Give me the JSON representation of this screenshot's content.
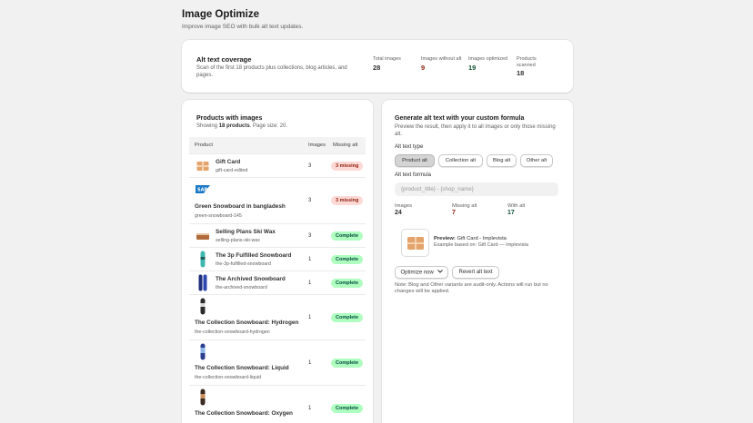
{
  "page": {
    "title": "Image Optimize",
    "subtitle": "Improve image SEO with bulk alt text updates."
  },
  "coverage": {
    "title": "Alt text coverage",
    "description": "Scan of the first 18 products plus collections, blog articles, and pages.",
    "stats": [
      {
        "label": "Total images",
        "value": "28",
        "color": "#303030"
      },
      {
        "label": "Images without alt",
        "value": "9",
        "color": "#8e1f0b"
      },
      {
        "label": "Images optimized",
        "value": "19",
        "color": "#0c5132"
      },
      {
        "label": "Products scanned",
        "value": "18",
        "color": "#303030"
      }
    ]
  },
  "products": {
    "title": "Products with images",
    "showing_prefix": "Showing ",
    "showing_count": "18 products",
    "showing_suffix": ". Page size: 20.",
    "columns": {
      "product": "Product",
      "images": "Images",
      "missing": "Missing alt"
    },
    "rows": [
      {
        "name": "Gift Card",
        "handle": "gift-card-edited",
        "images": "3",
        "status": "3 missing",
        "kind": "missing",
        "icon": "gift-card-icon"
      },
      {
        "name": "Green Snowboard in bangladesh",
        "handle": "green-snowboard-145",
        "images": "3",
        "status": "3 missing",
        "kind": "missing",
        "icon": "sap-logo-icon"
      },
      {
        "name": "Selling Plans Ski Wax",
        "handle": "selling-plans-ski-wax",
        "images": "3",
        "status": "Complete",
        "kind": "complete",
        "icon": "ski-wax-icon"
      },
      {
        "name": "The 3p Fulfilled Snowboard",
        "handle": "the-3p-fulfilled-snowboard",
        "images": "1",
        "status": "Complete",
        "kind": "complete",
        "icon": "snowboard-icon"
      },
      {
        "name": "The Archived Snowboard",
        "handle": "the-archived-snowboard",
        "images": "1",
        "status": "Complete",
        "kind": "complete",
        "icon": "snowboard-icon"
      },
      {
        "name": "The Collection Snowboard: Hydrogen",
        "handle": "the-collection-snowboard-hydrogen",
        "images": "1",
        "status": "Complete",
        "kind": "complete",
        "icon": "snowboard-icon"
      },
      {
        "name": "The Collection Snowboard: Liquid",
        "handle": "the-collection-snowboard-liquid",
        "images": "1",
        "status": "Complete",
        "kind": "complete",
        "icon": "snowboard-icon"
      },
      {
        "name": "The Collection Snowboard: Oxygen",
        "handle": "",
        "images": "1",
        "status": "Complete",
        "kind": "complete",
        "icon": "snowboard-icon"
      }
    ]
  },
  "generate": {
    "title": "Generate alt text with your custom formula",
    "description": "Preview the result, then apply it to all images or only those missing alt.",
    "type_label": "Alt text type",
    "types": [
      "Product alt",
      "Collection alt",
      "Blog alt",
      "Other alt"
    ],
    "formula_label": "Alt text formula",
    "formula_placeholder": "{product_title} - {shop_name}",
    "stats": [
      {
        "label": "Images",
        "value": "24",
        "color": "#303030"
      },
      {
        "label": "Missing alt",
        "value": "7",
        "color": "#8e1f0b"
      },
      {
        "label": "With alt",
        "value": "17",
        "color": "#0c5132"
      }
    ],
    "preview_label": "Preview:",
    "preview_value": " Gift Card - Implevista",
    "preview_example": "Example based on: Gift Card — Implevista",
    "optimize_label": "Optimize now",
    "revert_label": "Revert alt text",
    "note": "Note: Blog and Other variants are audit-only. Actions will run but no changes will be applied."
  }
}
